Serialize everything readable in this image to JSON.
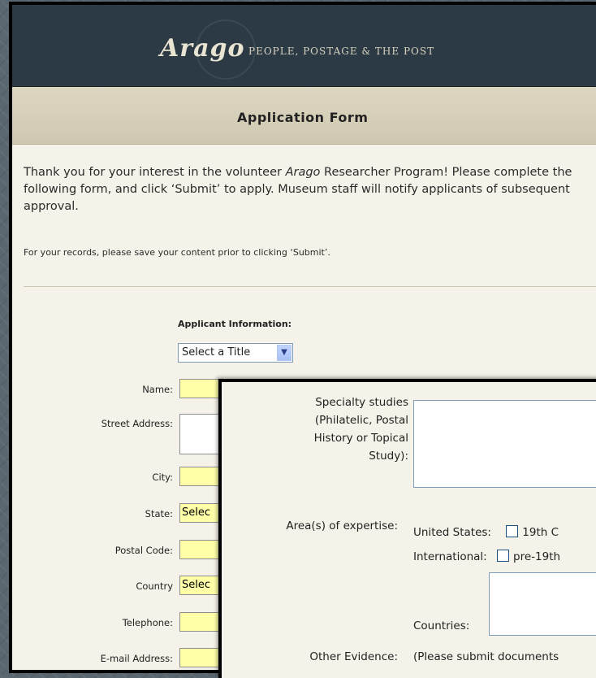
{
  "header": {
    "logo": "Arago",
    "tagline": "PEOPLE, POSTAGE & THE POST"
  },
  "form": {
    "title": "Application Form",
    "intro_before": "Thank you for your interest in the volunteer ",
    "intro_italic": "Arago",
    "intro_after": " Researcher Program! Please complete the following form, and click ‘Submit’ to apply. Museum staff will notify applicants of subsequent approval.",
    "note": "For your records, please save your content prior to clicking ‘Submit’.",
    "section_title": "Applicant Information:",
    "title_select": "Select a Title",
    "fields": {
      "name": "Name:",
      "street": "Street Address:",
      "city": "City:",
      "state": "State:",
      "state_value": "Selec",
      "postal": "Postal Code:",
      "country": "Country",
      "country_value": "Selec",
      "telephone": "Telephone:",
      "email": "E-mail Address:"
    }
  },
  "overlay": {
    "specialty_label_1": "Specialty studies",
    "specialty_label_2": "(Philatelic, Postal",
    "specialty_label_3": "History or Topical",
    "specialty_label_4": "Study):",
    "expertise_label": "Area(s) of expertise:",
    "united_states": "United States:",
    "us_option": "19th C",
    "international": "International:",
    "intl_option": "pre-19th",
    "countries": "Countries:",
    "other_evidence_label": "Other Evidence:",
    "other_evidence_text": "(Please submit documents"
  }
}
